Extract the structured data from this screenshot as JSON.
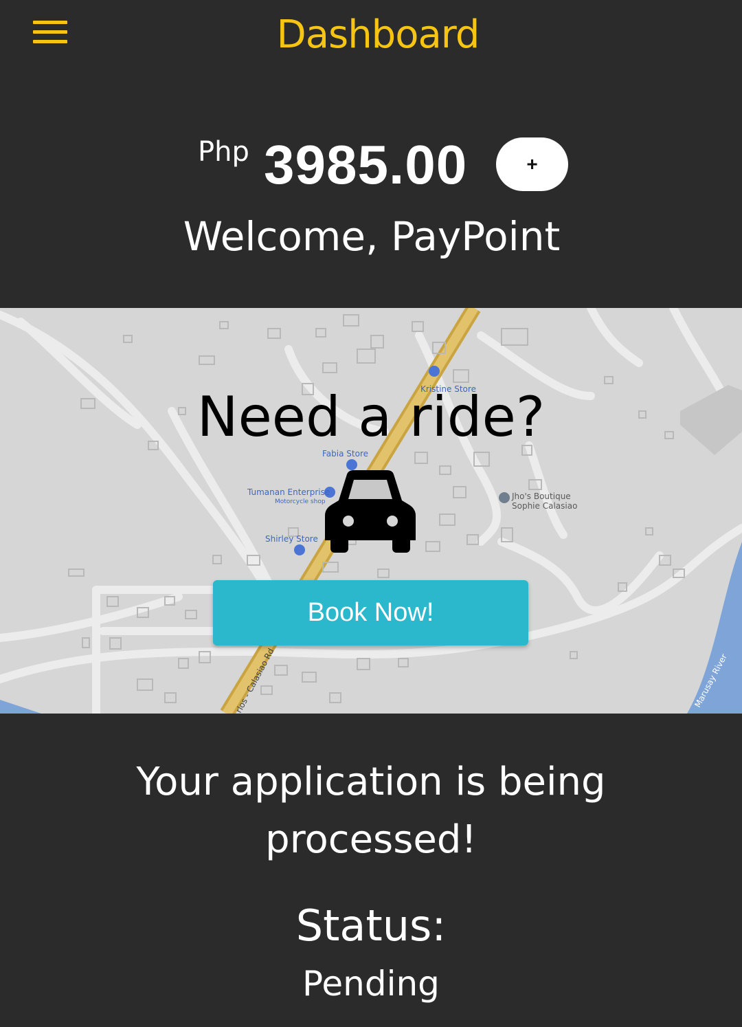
{
  "appbar": {
    "title": "Dashboard",
    "menu_icon": "hamburger-menu-icon",
    "accent": "#f6c514"
  },
  "wallet": {
    "currency": "Php",
    "balance": "3985.00",
    "topup_label": "+",
    "welcome": "Welcome, PayPoint"
  },
  "ride": {
    "heading": "Need a ride?",
    "car_icon": "car-icon",
    "book_label": "Book Now!",
    "book_color": "#2bb8cc",
    "map_labels": {
      "kristine": "Kristine Store",
      "fabia": "Fabia Store",
      "tumanan": "Tumanan Enterprise",
      "tumanan_sub": "Motorcycle shop",
      "jhos": "Jho's Boutique",
      "jhos_sub": "Sophie Calasiao",
      "shirley": "Shirley Store",
      "road": "rlos - Calasiao Rd",
      "river": "Marusay River"
    }
  },
  "application": {
    "message": "Your application is being processed!",
    "status_label": "Status:",
    "status_value": "Pending"
  }
}
